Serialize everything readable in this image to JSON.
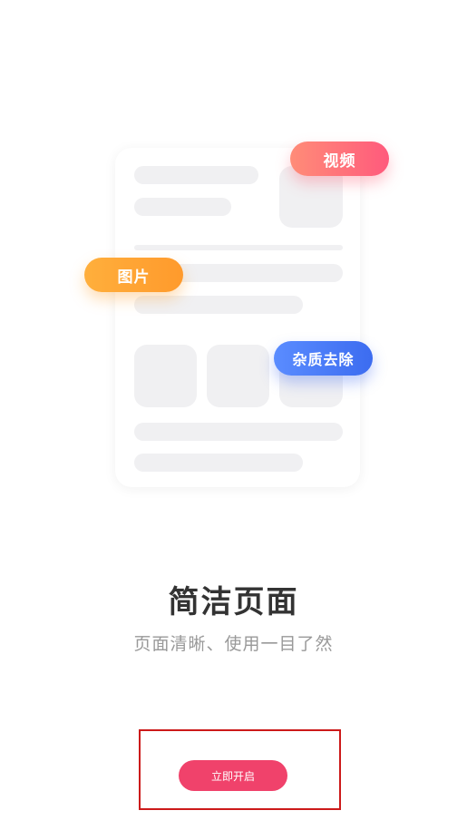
{
  "illustration": {
    "tags": {
      "video": "视频",
      "image": "图片",
      "denoise": "杂质去除"
    },
    "colors": {
      "video_tag": "#ff6a7c",
      "image_tag": "#ffa532",
      "denoise_tag": "#4a7cf5",
      "placeholder": "#f0f0f2"
    }
  },
  "content": {
    "title": "简洁页面",
    "subtitle": "页面清晰、使用一目了然"
  },
  "actions": {
    "start_label": "立即开启",
    "start_color": "#f0426b"
  }
}
